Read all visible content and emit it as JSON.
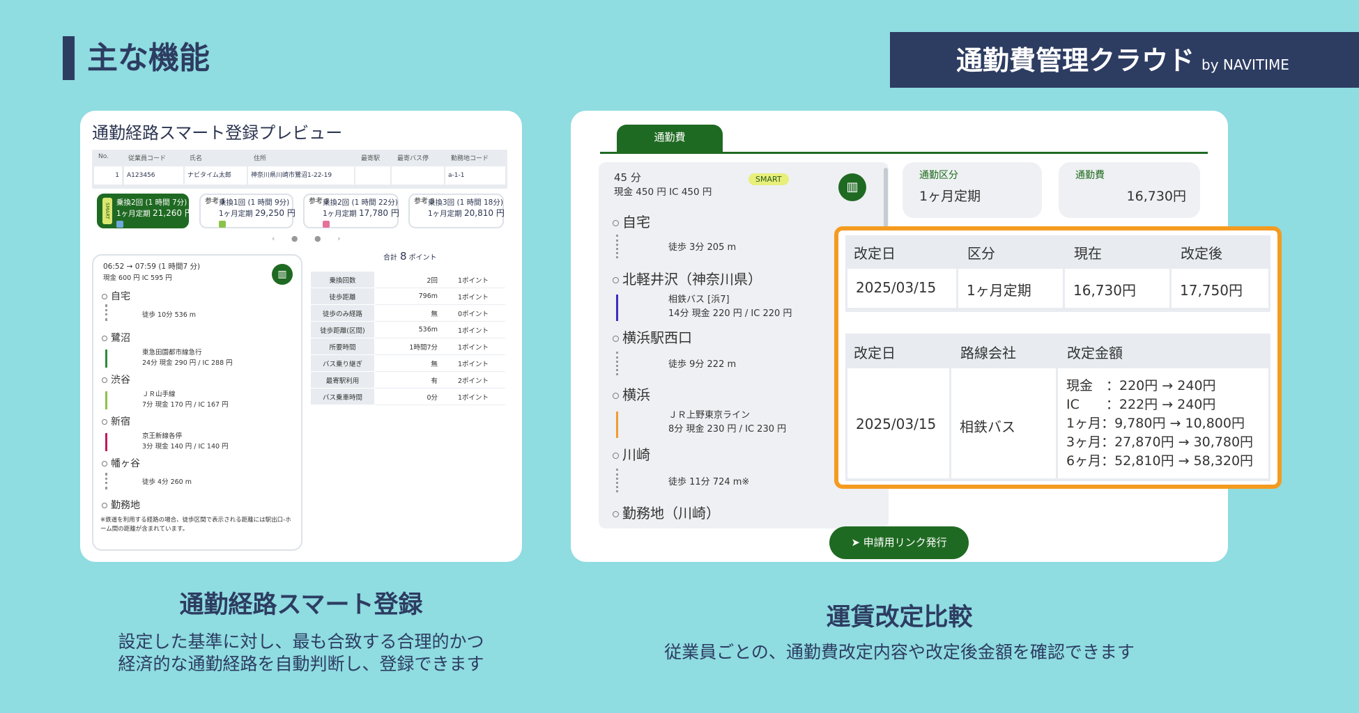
{
  "header": {
    "section_title": "主な機能",
    "brand_name": "通勤費管理クラウド",
    "brand_by": "by NAVITIME"
  },
  "left_card": {
    "title": "通勤経路スマート登録プレビュー",
    "employee_table": {
      "headers": [
        "No.",
        "従業員コード",
        "氏名",
        "住所",
        "最寄駅",
        "最寄バス停",
        "勤務地コード"
      ],
      "row": [
        "1",
        "A123456",
        "ナビタイム太郎",
        "神奈川県川崎市鷺沼1-22-19",
        "",
        "",
        "a-1-1"
      ]
    },
    "route_cards": [
      {
        "badge": "SMART",
        "line1": "乗換2回 (1 時間 7分)",
        "line2": "1ヶ月定期",
        "price": "21,260 円",
        "icon_color": "#6fa8dc",
        "selected": true
      },
      {
        "badge": "参考 1",
        "line1": "乗換1回 (1 時間 9分)",
        "line2": "1ヶ月定期",
        "price": "29,250 円",
        "icon_color": "#8bc34a",
        "selected": false
      },
      {
        "badge": "参考 2",
        "line1": "乗換2回 (1 時間 22分)",
        "line2": "1ヶ月定期",
        "price": "17,780 円",
        "icon_color": "#e57399",
        "selected": false
      },
      {
        "badge": "参考 3",
        "line1": "乗換3回 (1 時間 18分)",
        "line2": "1ヶ月定期",
        "price": "20,810 円",
        "icon_color": "",
        "selected": false
      }
    ],
    "pager": "‹  ●  ●  ›",
    "route_detail": {
      "time": "06:52 → 07:59 (1 時間7 分)",
      "fare": "現金 600 円  IC 595 円",
      "map_icon": "map-icon",
      "stops": [
        "自宅",
        "鷺沼",
        "渋谷",
        "新宿",
        "幡ヶ谷",
        "勤務地"
      ],
      "segments": [
        {
          "line": "徒歩 10分   536 m",
          "sub": "",
          "color": ""
        },
        {
          "line": "東急田園都市線急行",
          "sub": "24分   現金 290 円 / IC 288 円",
          "color": "#2e8b3a"
        },
        {
          "line": "ＪＲ山手線",
          "sub": "7分   現金 170 円 / IC 167 円",
          "color": "#8bc34a"
        },
        {
          "line": "京王新線各停",
          "sub": "3分   現金 140 円 / IC 140 円",
          "color": "#c2185b"
        },
        {
          "line": "徒歩 4分    260 m",
          "sub": "",
          "color": ""
        }
      ],
      "note": "※鉄道を利用する経路の場合、徒歩区間で表示される距離には駅出口-ホーム間の距離が含まれています。"
    },
    "points": {
      "total_label": "合計",
      "total_value": "8",
      "total_unit": "ポイント",
      "rows": [
        [
          "乗換回数",
          "2回",
          "1ポイント"
        ],
        [
          "徒歩距離",
          "796m",
          "1ポイント"
        ],
        [
          "徒歩のみ経路",
          "無",
          "0ポイント"
        ],
        [
          "徒歩距離(区間)",
          "536m",
          "1ポイント"
        ],
        [
          "所要時間",
          "1時間7分",
          "1ポイント"
        ],
        [
          "バス乗り継ぎ",
          "無",
          "1ポイント"
        ],
        [
          "最寄駅利用",
          "有",
          "2ポイント"
        ],
        [
          "バス乗車時間",
          "0分",
          "1ポイント"
        ]
      ]
    }
  },
  "right_card": {
    "tab": "通勤費",
    "route": {
      "time": "45 分",
      "fare": "現金 450 円  IC 450 円",
      "smart": "SMART",
      "stops": [
        "自宅",
        "北軽井沢（神奈川県）",
        "横浜駅西口",
        "横浜",
        "川崎",
        "勤務地（川崎）"
      ],
      "segments": [
        {
          "line": "徒歩 3分    205 m",
          "sub": "",
          "color": ""
        },
        {
          "line": "相鉄バス [浜7]",
          "sub": "14分    現金 220 円 / IC 220 円",
          "color": "#3b2dbf"
        },
        {
          "line": "徒歩 9分    222 m",
          "sub": "",
          "color": ""
        },
        {
          "line": "ＪＲ上野東京ライン",
          "sub": "8分    現金 230 円 / IC 230 円",
          "color": "#f29b30"
        },
        {
          "line": "徒歩 11分    724 m※",
          "sub": "",
          "color": ""
        }
      ]
    },
    "kubun": {
      "label": "通勤区分",
      "value": "1ヶ月定期"
    },
    "fee": {
      "label": "通勤費",
      "value": "16,730円"
    },
    "revision": {
      "headers1": [
        "改定日",
        "区分",
        "現在",
        "改定後"
      ],
      "row1": [
        "2025/03/15",
        "1ヶ月定期",
        "16,730円",
        "17,750円"
      ],
      "headers2": [
        "改定日",
        "路線会社",
        "改定金額"
      ],
      "row2_date": "2025/03/15",
      "row2_company": "相鉄バス",
      "row2_amounts": [
        "現金　：220円 → 240円",
        "IC　　：222円 → 240円",
        "1ヶ月：9,780円 → 10,800円",
        "3ヶ月：27,870円 → 30,780円",
        "6ヶ月：52,810円 → 58,320円"
      ]
    },
    "issue_button": "申請用リンク発行"
  },
  "captions": {
    "left_title": "通勤経路スマート登録",
    "left_desc": [
      "設定した基準に対し、最も合致する合理的かつ",
      "経済的な通勤経路を自動判断し、登録できます"
    ],
    "right_title": "運賃改定比較",
    "right_desc": "従業員ごとの、通勤費改定内容や改定後金額を確認できます"
  }
}
